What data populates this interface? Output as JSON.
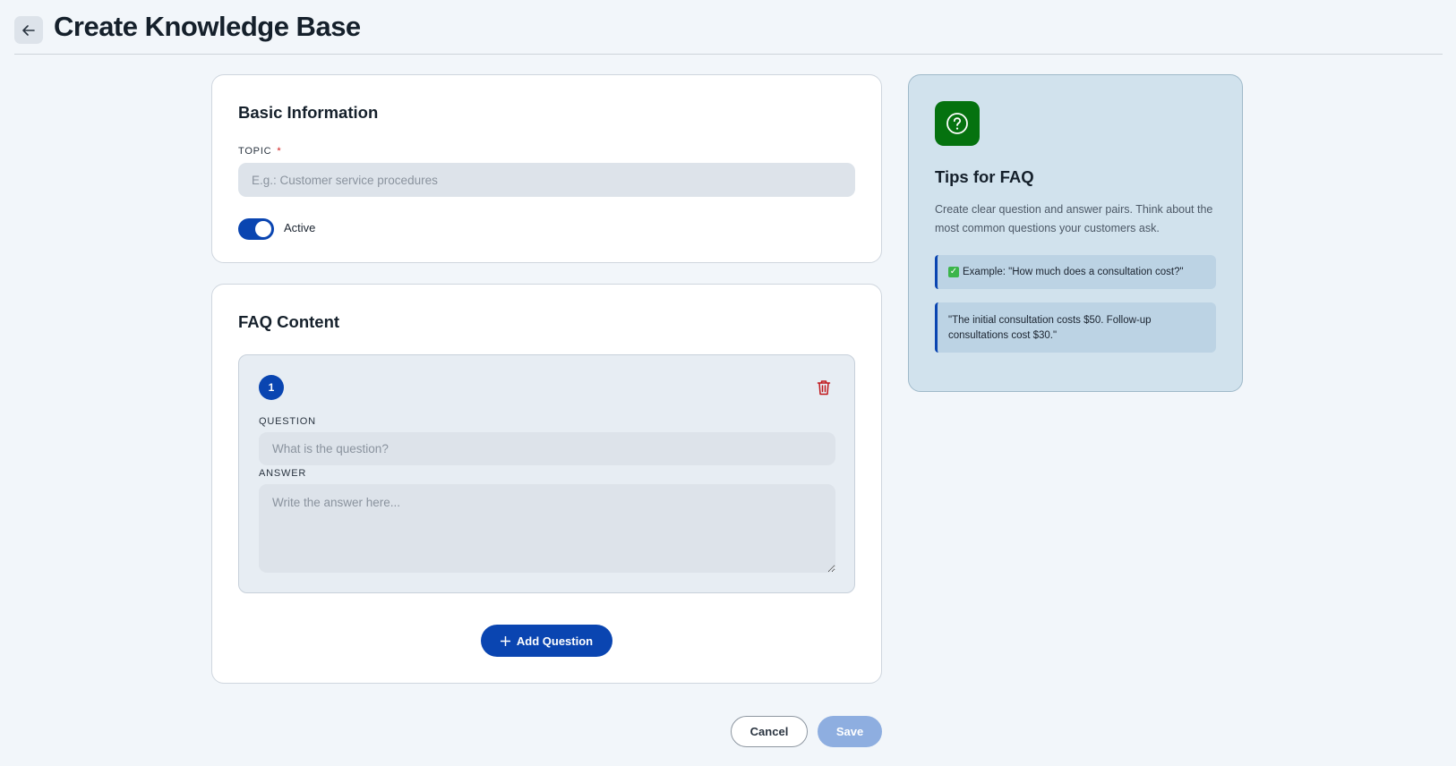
{
  "header": {
    "title": "Create Knowledge Base",
    "back_icon": "arrow-left-icon"
  },
  "basic_info": {
    "title": "Basic Information",
    "topic_label": "TOPIC",
    "topic_required_mark": "*",
    "topic_placeholder": "E.g.: Customer service procedures",
    "topic_value": "",
    "active_label": "Active",
    "active_on": true
  },
  "faq": {
    "title": "FAQ Content",
    "items": [
      {
        "number": "1",
        "question_label": "QUESTION",
        "question_placeholder": "What is the question?",
        "question_value": "",
        "answer_label": "ANSWER",
        "answer_placeholder": "Write the answer here...",
        "answer_value": ""
      }
    ],
    "add_button_label": "Add Question"
  },
  "actions": {
    "cancel_label": "Cancel",
    "save_label": "Save"
  },
  "tips": {
    "icon": "question-circle-icon",
    "title": "Tips for FAQ",
    "text": "Create clear question and answer pairs. Think about the most common questions your customers ask.",
    "example_question": "Example: \"How much does a consultation cost?\"",
    "example_answer": "\"The initial consultation costs $50. Follow-up consultations cost $30.\""
  },
  "colors": {
    "primary": "#0a45b1",
    "tips_icon_bg": "#05720f",
    "delete": "#c0161a",
    "save_disabled": "#8eaee0"
  }
}
